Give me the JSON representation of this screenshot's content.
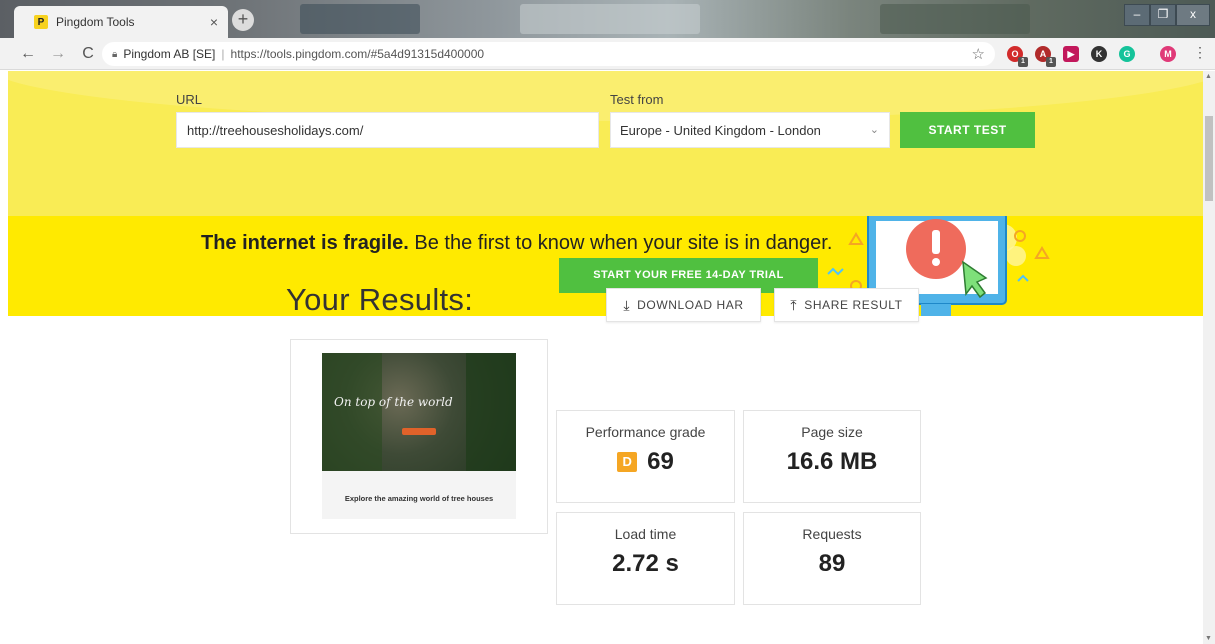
{
  "browser": {
    "tab_title": "Pingdom Tools",
    "tab_favicon_letter": "P",
    "tab_close": "×",
    "new_tab": "+",
    "window_controls": [
      "–",
      "❐",
      "x"
    ],
    "site_identity": "Pingdom AB [SE]",
    "address_url": "https://tools.pingdom.com/#5a4d91315d400000",
    "avatar_letter": "M",
    "extensions": [
      {
        "name": "opera-ext-icon",
        "color": "#d22b2b",
        "badge": "1"
      },
      {
        "name": "abp-ext-icon",
        "color": "#b12b2b",
        "badge": "1"
      },
      {
        "name": "screencast-ext-icon",
        "color": "#c2185b"
      },
      {
        "name": "k-ext-icon",
        "color": "#333333"
      },
      {
        "name": "grammarly-ext-icon",
        "color": "#15c39a"
      }
    ]
  },
  "test_form": {
    "url_label": "URL",
    "url_value": "http://treehousesholidays.com/",
    "location_label": "Test from",
    "location_value": "Europe - United Kingdom - London",
    "start_button": "START TEST"
  },
  "promo": {
    "headline_bold": "The internet is fragile.",
    "headline_rest": " Be the first to know when your site is in danger.",
    "trial_button": "START YOUR FREE 14-DAY TRIAL"
  },
  "results": {
    "title": "Your Results:",
    "download_button": "DOWNLOAD HAR",
    "share_button": "SHARE RESULT",
    "performance_label": "Performance grade",
    "performance_letter": "D",
    "performance_score": "69",
    "page_size_label": "Page size",
    "page_size_value": "16.6 MB",
    "load_time_label": "Load time",
    "load_time_value": "2.72 s",
    "requests_label": "Requests",
    "requests_value": "89",
    "screenshot_script": "On top of the world",
    "screenshot_tagline": "Explore the amazing world of tree houses"
  },
  "colors": {
    "hero_yellow": "#f9ec55",
    "banner_yellow": "#ffea00",
    "cta_green": "#50c040",
    "grade_orange": "#f5a623"
  }
}
